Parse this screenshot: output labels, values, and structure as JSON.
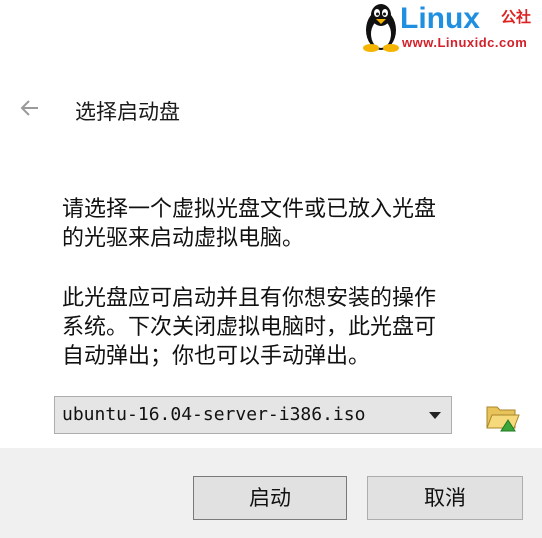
{
  "watermark": {
    "title": "Linux",
    "suffix": "公社",
    "url": "www.Linuxidc.com"
  },
  "header": {
    "back_icon": "back-arrow-icon",
    "title": "选择启动盘"
  },
  "body": {
    "paragraph1_lines": [
      "请选择一个虚拟光盘文件或已放入光盘",
      "的光驱来启动虚拟电脑。"
    ],
    "paragraph2_lines": [
      "此光盘应可启动并且有你想安装的操作",
      "系统。下次关闭虚拟电脑时，此光盘可",
      "自动弹出；你也可以手动弹出。"
    ]
  },
  "iso_select": {
    "value": "ubuntu-16.04-server-i386.iso",
    "icon": "chevron-down-icon"
  },
  "folder_button": {
    "icon": "folder-open-icon"
  },
  "buttons": {
    "start_label": "启动",
    "cancel_label": "取消"
  }
}
